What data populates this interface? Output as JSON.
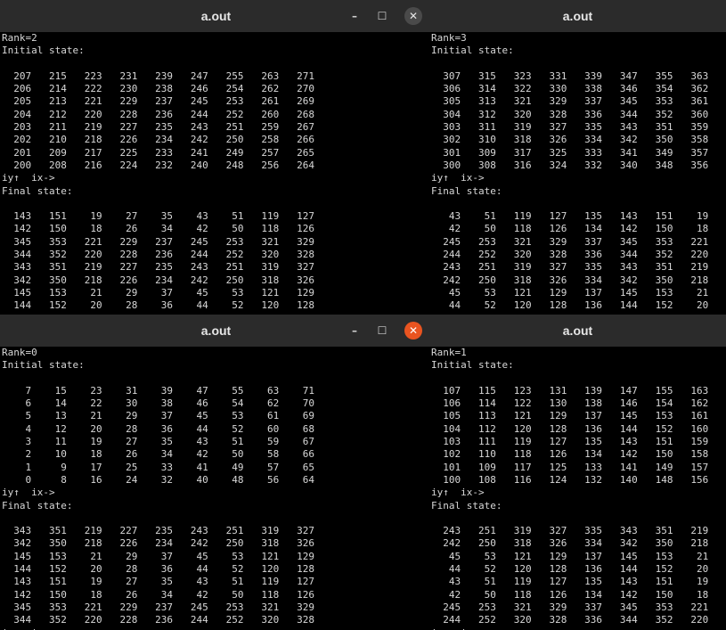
{
  "windows": {
    "top_left": {
      "title": "a.out",
      "text": "Rank=2\nInitial state:\n\n  207   215   223   231   239   247   255   263   271\n  206   214   222   230   238   246   254   262   270\n  205   213   221   229   237   245   253   261   269\n  204   212   220   228   236   244   252   260   268\n  203   211   219   227   235   243   251   259   267\n  202   210   218   226   234   242   250   258   266\n  201   209   217   225   233   241   249   257   265\n  200   208   216   224   232   240   248   256   264\niy↑  ix->\nFinal state:\n\n  143   151    19    27    35    43    51   119   127\n  142   150    18    26    34    42    50   118   126\n  345   353   221   229   237   245   253   321   329\n  344   352   220   228   236   244   252   320   328\n  343   351   219   227   235   243   251   319   327\n  342   350   218   226   234   242   250   318   326\n  145   153    21    29    37    45    53   121   129\n  144   152    20    28    36    44    52   120   128\niy↑  ix->"
    },
    "top_right": {
      "title": "a.out",
      "text": "Rank=3\nInitial state:\n\n  307   315   323   331   339   347   355   363   371\n  306   314   322   330   338   346   354   362   370\n  305   313   321   329   337   345   353   361   369\n  304   312   320   328   336   344   352   360   368\n  303   311   319   327   335   343   351   359   367\n  302   310   318   326   334   342   350   358   366\n  301   309   317   325   333   341   349   357   365\n  300   308   316   324   332   340   348   356   364\niy↑  ix->\nFinal state:\n\n   43    51   119   127   135   143   151    19    27\n   42    50   118   126   134   142   150    18    26\n  245   253   321   329   337   345   353   221   229\n  244   252   320   328   336   344   352   220   228\n  243   251   319   327   335   343   351   219   227\n  242   250   318   326   334   342   350   218   226\n   45    53   121   129   137   145   153    21    29\n   44    52   120   128   136   144   152    20    28\niy↑  ix->"
    },
    "bottom_left": {
      "title": "a.out",
      "text": "Rank=0\nInitial state:\n\n    7    15    23    31    39    47    55    63    71\n    6    14    22    30    38    46    54    62    70\n    5    13    21    29    37    45    53    61    69\n    4    12    20    28    36    44    52    60    68\n    3    11    19    27    35    43    51    59    67\n    2    10    18    26    34    42    50    58    66\n    1     9    17    25    33    41    49    57    65\n    0     8    16    24    32    40    48    56    64\niy↑  ix->\nFinal state:\n\n  343   351   219   227   235   243   251   319   327\n  342   350   218   226   234   242   250   318   326\n  145   153    21    29    37    45    53   121   129\n  144   152    20    28    36    44    52   120   128\n  143   151    19    27    35    43    51   119   127\n  142   150    18    26    34    42    50   118   126\n  345   353   221   229   237   245   253   321   329\n  344   352   220   228   236   244   252   320   328\niy↑  ix->"
    },
    "bottom_right": {
      "title": "a.out",
      "text": "Rank=1\nInitial state:\n\n  107   115   123   131   139   147   155   163   171\n  106   114   122   130   138   146   154   162   170\n  105   113   121   129   137   145   153   161   169\n  104   112   120   128   136   144   152   160   168\n  103   111   119   127   135   143   151   159   167\n  102   110   118   126   134   142   150   158   166\n  101   109   117   125   133   141   149   157   165\n  100   108   116   124   132   140   148   156   164\niy↑  ix->\nFinal state:\n\n  243   251   319   327   335   343   351   219   227\n  242   250   318   326   334   342   350   218   226\n   45    53   121   129   137   145   153    21    29\n   44    52   120   128   136   144   152    20    28\n   43    51   119   127   135   143   151    19    27\n   42    50   118   126   134   142   150    18    26\n  245   253   321   329   337   345   353   221   229\n  244   252   320   328   336   344   352   220   228\niy↑  ix->"
    }
  },
  "controls": {
    "minimize": "–",
    "maximize": "☐",
    "close": "✕"
  },
  "colors": {
    "close_active": "#e95420",
    "close_inactive": "#4a4a4a",
    "titlebar": "#2b2b2b",
    "terminal_bg": "#000000",
    "terminal_fg": "#d8d8d8"
  }
}
